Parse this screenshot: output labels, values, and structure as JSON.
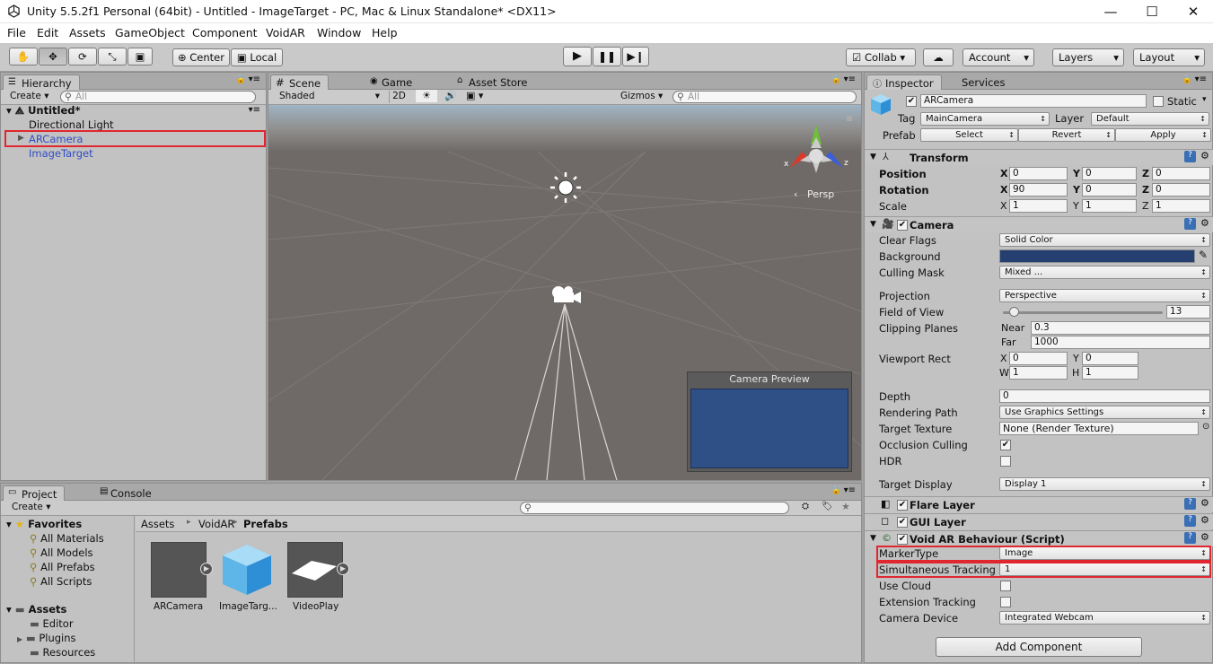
{
  "window": {
    "title": "Unity 5.5.2f1 Personal (64bit) - Untitled - ImageTarget - PC, Mac & Linux Standalone* <DX11>",
    "minimize": "—",
    "maximize": "☐",
    "close": "✕"
  },
  "menu": [
    "File",
    "Edit",
    "Assets",
    "GameObject",
    "Component",
    "VoidAR",
    "Window",
    "Help"
  ],
  "toolbar": {
    "pivot": "Center",
    "space": "Local",
    "collab": "Collab",
    "account": "Account",
    "layers": "Layers",
    "layout": "Layout"
  },
  "hierarchy": {
    "tab": "Hierarchy",
    "create": "Create",
    "search": "All",
    "scene": "Untitled*",
    "items": [
      "Directional Light",
      "ARCamera",
      "ImageTarget"
    ]
  },
  "scene": {
    "tabs": [
      "Scene",
      "Game",
      "Asset Store"
    ],
    "shading": "Shaded",
    "mode2d": "2D",
    "gizmos": "Gizmos",
    "search": "All",
    "persp": "Persp",
    "preview_title": "Camera Preview",
    "gizmo_x": "x",
    "gizmo_z": "z"
  },
  "project": {
    "tabs": [
      "Project",
      "Console"
    ],
    "create": "Create",
    "favorites_title": "Favorites",
    "favorites": [
      "All Materials",
      "All Models",
      "All Prefabs",
      "All Scripts"
    ],
    "assets_title": "Assets",
    "assets": [
      "Editor",
      "Plugins",
      "Resources"
    ],
    "breadcrumb": [
      "Assets",
      "VoidAR",
      "Prefabs"
    ],
    "files": [
      "ARCamera",
      "ImageTarg...",
      "VideoPlay"
    ]
  },
  "inspector": {
    "tabs": [
      "Inspector",
      "Services"
    ],
    "object_name": "ARCamera",
    "static_label": "Static",
    "tag_label": "Tag",
    "tag": "MainCamera",
    "layer_label": "Layer",
    "layer": "Default",
    "prefab_label": "Prefab",
    "prefab_buttons": [
      "Select",
      "Revert",
      "Apply"
    ],
    "transform": {
      "title": "Transform",
      "rows": [
        {
          "label": "Position",
          "x": "0",
          "y": "0",
          "z": "0"
        },
        {
          "label": "Rotation",
          "x": "90",
          "y": "0",
          "z": "0"
        },
        {
          "label": "Scale",
          "x": "1",
          "y": "1",
          "z": "1"
        }
      ]
    },
    "camera": {
      "title": "Camera",
      "clear_flags_label": "Clear Flags",
      "clear_flags": "Solid Color",
      "background_label": "Background",
      "background_color": "#253f70",
      "culling_label": "Culling Mask",
      "culling": "Mixed ...",
      "projection_label": "Projection",
      "projection": "Perspective",
      "fov_label": "Field of View",
      "fov": "13",
      "clipping_label": "Clipping Planes",
      "near_label": "Near",
      "near": "0.3",
      "far_label": "Far",
      "far": "1000",
      "viewport_label": "Viewport Rect",
      "vx": "0",
      "vy": "0",
      "vw": "1",
      "vh": "1",
      "depth_label": "Depth",
      "depth": "0",
      "rendering_label": "Rendering Path",
      "rendering": "Use Graphics Settings",
      "target_tex_label": "Target Texture",
      "target_tex": "None (Render Texture)",
      "occlusion_label": "Occlusion Culling",
      "hdr_label": "HDR",
      "target_display_label": "Target Display",
      "target_display": "Display 1"
    },
    "flare": "Flare Layer",
    "gui": "GUI Layer",
    "voidar": {
      "title": "Void AR Behaviour (Script)",
      "marker_label": "MarkerType",
      "marker": "Image",
      "simul_label": "Simultaneous Tracking",
      "simul": "1",
      "cloud_label": "Use Cloud",
      "ext_label": "Extension Tracking",
      "device_label": "Camera Device",
      "device": "Integrated Webcam"
    },
    "add_component": "Add Component"
  },
  "axes": {
    "x": "X",
    "y": "Y",
    "z": "Z",
    "w": "W",
    "h": "H"
  }
}
